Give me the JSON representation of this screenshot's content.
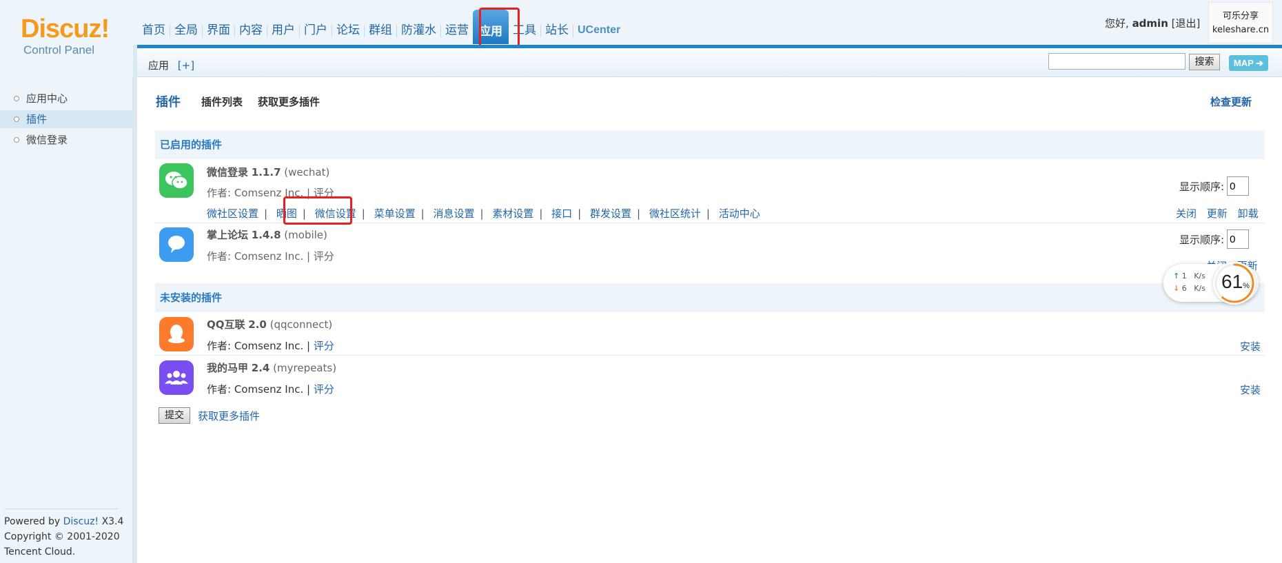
{
  "header": {
    "logo_brand": "Discuz!",
    "logo_sub": "Control Panel",
    "nav": [
      "首页",
      "全局",
      "界面",
      "内容",
      "用户",
      "门户",
      "论坛",
      "群组",
      "防灌水",
      "运营",
      "应用",
      "工具",
      "站长",
      "UCenter"
    ],
    "nav_active": "应用",
    "greeting": "您好,",
    "username": "admin",
    "logout": "[退出]",
    "watermark_line1": "可乐分享",
    "watermark_line2": "keleshare.cn",
    "breadcrumb": "应用",
    "breadcrumb_add": "[+]",
    "search_button": "搜索",
    "map_button": "MAP ➔"
  },
  "sidebar": {
    "items": [
      {
        "label": "应用中心",
        "active": false
      },
      {
        "label": "插件",
        "active": true
      },
      {
        "label": "微信登录",
        "active": false
      }
    ],
    "footer": {
      "powered": "Powered by",
      "brand": "Discuz!",
      "version": "X3.4",
      "copyright": "Copyright © 2001-2020",
      "company": "Tencent Cloud."
    }
  },
  "main": {
    "title": "插件",
    "tabs": [
      "插件列表",
      "获取更多插件"
    ],
    "check_update": "检查更新",
    "enabled_title": "已启用的插件",
    "uninstalled_title": "未安装的插件",
    "order_label": "显示顺序:",
    "enabled": [
      {
        "name": "微信登录",
        "version": "1.1.7",
        "id": "(wechat)",
        "author": "作者: Comsenz Inc. | 评分",
        "order": "0",
        "links": [
          "微社区设置",
          "晒图",
          "微信设置",
          "菜单设置",
          "消息设置",
          "素材设置",
          "接口",
          "群发设置",
          "微社区统计",
          "活动中心"
        ],
        "actions": [
          "关闭",
          "更新",
          "卸载"
        ]
      },
      {
        "name": "掌上论坛",
        "version": "1.4.8",
        "id": "(mobile)",
        "author": "作者: Comsenz Inc. | 评分",
        "order": "0",
        "actions": [
          "关闭",
          "更新"
        ]
      }
    ],
    "uninstalled": [
      {
        "name": "QQ互联",
        "version": "2.0",
        "id": "(qqconnect)",
        "author_prefix": "作者: Comsenz Inc. |",
        "rate": "评分",
        "install": "安装"
      },
      {
        "name": "我的马甲",
        "version": "2.4",
        "id": "(myrepeats)",
        "author_prefix": "作者: Comsenz Inc. |",
        "rate": "评分",
        "install": "安装"
      }
    ],
    "submit": "提交",
    "more_plugins": "获取更多插件"
  },
  "net_widget": {
    "up": "1",
    "down": "6",
    "unit": "K/s",
    "percent": "61",
    "percent_sign": "%"
  },
  "colors": {
    "accent": "#2366a8",
    "nav_active": "#1f78c4",
    "highlight_box": "#e81f1f",
    "wechat_green": "#3cc55d",
    "mobile_blue": "#3d9bf0",
    "qq_orange": "#ff7a2b",
    "myrepeats_purple": "#7a4df0"
  }
}
